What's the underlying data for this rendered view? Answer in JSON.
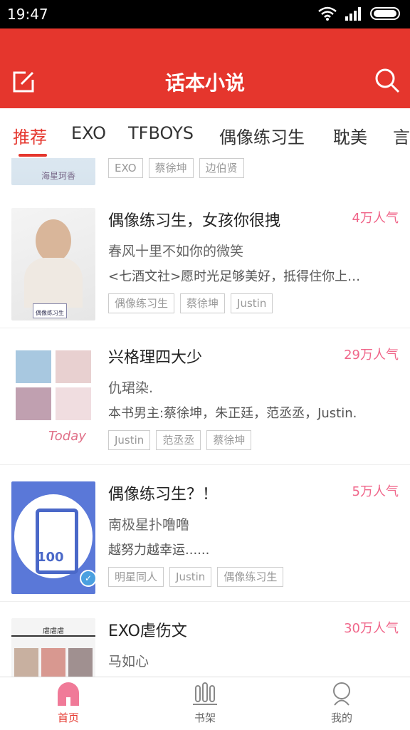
{
  "statusbar": {
    "time": "19:47"
  },
  "app": {
    "title": "话本小说",
    "accent": "#e5362d"
  },
  "tabs": [
    {
      "label": "推荐"
    },
    {
      "label": "EXO"
    },
    {
      "label": "TFBOYS"
    },
    {
      "label": "偶像练习生"
    },
    {
      "label": "耽美"
    },
    {
      "label": "言"
    }
  ],
  "partial_card": {
    "cover_text": "海星珂香",
    "tags": [
      "EXO",
      "蔡徐坤",
      "边伯贤"
    ]
  },
  "cards": [
    {
      "title": "偶像练习生，女孩你很拽",
      "popularity": "4万人气",
      "author": "春风十里不如你的微笑",
      "desc": "<七酒文社>愿时光足够美好，抵得住你上…",
      "tags": [
        "偶像练习生",
        "蔡徐坤",
        "Justin"
      ],
      "cover_text": "偶像练习生"
    },
    {
      "title": "兴格理四大少",
      "popularity": "29万人气",
      "author": "仇珺染.",
      "desc": "本书男主:蔡徐坤，朱正廷，范丞丞，Justin.",
      "tags": [
        "Justin",
        "范丞丞",
        "蔡徐坤"
      ],
      "cover_text": "Today"
    },
    {
      "title": "偶像练习生？！",
      "popularity": "5万人气",
      "author": "南极星扑噜噜",
      "desc": "越努力越幸运......",
      "tags": [
        "明星同人",
        "Justin",
        "偶像练习生"
      ],
      "cover_text": "100"
    },
    {
      "title": "EXO虐伤文",
      "popularity": "30万人气",
      "author": "马如心",
      "desc": "",
      "tags": [],
      "cover_text": "虐虐虐"
    }
  ],
  "bottom_nav": [
    {
      "label": "首页",
      "icon": "home-icon"
    },
    {
      "label": "书架",
      "icon": "bookshelf-icon"
    },
    {
      "label": "我的",
      "icon": "profile-icon"
    }
  ]
}
